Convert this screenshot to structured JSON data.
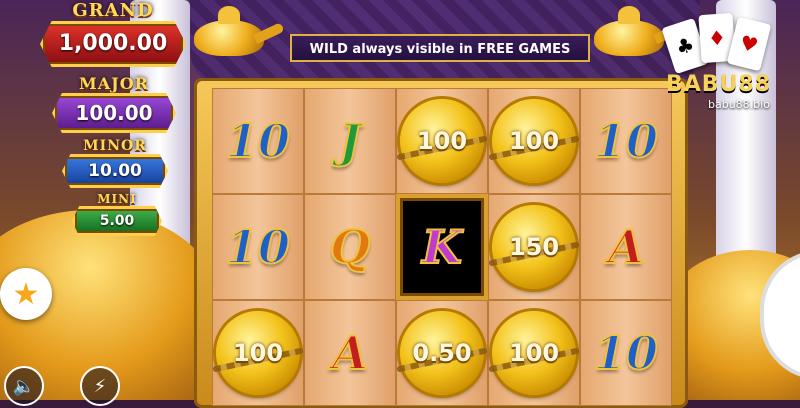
{
  "jackpots": {
    "grand": {
      "title": "GRAND",
      "value": "1,000.00"
    },
    "major": {
      "title": "MAJOR",
      "value": "100.00"
    },
    "minor": {
      "title": "MINOR",
      "value": "10.00"
    },
    "mini": {
      "title": "MINI",
      "value": "5.00"
    }
  },
  "banner": {
    "text": "WILD always visible in FREE GAMES"
  },
  "reels": {
    "rows": [
      [
        {
          "type": "letter",
          "value": "10",
          "color": "blue"
        },
        {
          "type": "letter",
          "value": "J",
          "color": "green"
        },
        {
          "type": "coin",
          "value": "100"
        },
        {
          "type": "coin",
          "value": "100"
        },
        {
          "type": "letter",
          "value": "10",
          "color": "blue"
        }
      ],
      [
        {
          "type": "letter",
          "value": "10",
          "color": "blue"
        },
        {
          "type": "letter",
          "value": "Q",
          "color": "orange"
        },
        {
          "type": "wild",
          "value": "K",
          "color": "purple"
        },
        {
          "type": "coin",
          "value": "150"
        },
        {
          "type": "letter",
          "value": "A",
          "color": "red"
        }
      ],
      [
        {
          "type": "coin",
          "value": "100"
        },
        {
          "type": "letter",
          "value": "A",
          "color": "red"
        },
        {
          "type": "coin",
          "value": "0.50"
        },
        {
          "type": "coin",
          "value": "100"
        },
        {
          "type": "letter",
          "value": "10",
          "color": "blue"
        }
      ]
    ]
  },
  "logo": {
    "name": "BABU88",
    "url": "babu88.bio",
    "cards": [
      "♣",
      "♦",
      "♥"
    ]
  },
  "controls": {
    "favorite_icon": "star-icon",
    "sound_icon": "speaker-icon",
    "turbo_icon": "lightning-icon"
  },
  "colors": {
    "grand": "#c2201e",
    "major": "#7a2ab0",
    "minor": "#2a5ac0",
    "mini": "#1f8a2a",
    "accent": "#ffd75a"
  }
}
